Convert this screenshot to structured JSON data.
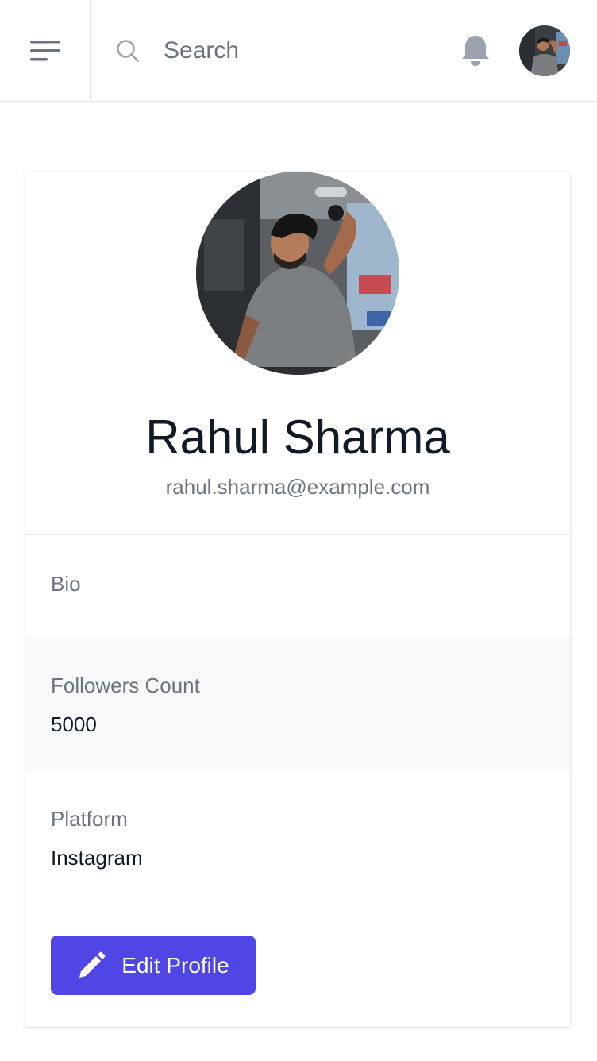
{
  "header": {
    "search_placeholder": "Search"
  },
  "profile": {
    "name": "Rahul Sharma",
    "email": "rahul.sharma@example.com",
    "fields": [
      {
        "label": "Bio",
        "value": ""
      },
      {
        "label": "Followers Count",
        "value": "5000"
      },
      {
        "label": "Platform",
        "value": "Instagram"
      }
    ],
    "edit_label": "Edit Profile"
  },
  "icons": {
    "menu": "menu-icon",
    "search": "search-icon",
    "notifications": "bell-icon",
    "edit": "pencil-icon"
  },
  "colors": {
    "accent": "#4f46e5",
    "text_primary": "#111827",
    "text_muted": "#6b7280",
    "row_shade": "#f8f9fb"
  }
}
